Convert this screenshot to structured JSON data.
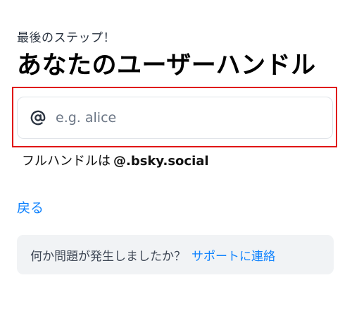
{
  "header": {
    "step_label": "最後のステップ！",
    "title": "あなたのユーザーハンドル"
  },
  "handle_field": {
    "icon": "at-icon",
    "placeholder": "e.g. alice",
    "value": ""
  },
  "full_handle": {
    "prefix": "フルハンドルは",
    "domain": "@.bsky.social"
  },
  "navigation": {
    "back_label": "戻る"
  },
  "help": {
    "text": "何か問題が発生しましたか？",
    "link_label": "サポートに連絡"
  },
  "colors": {
    "accent": "#1083fe",
    "highlight_border": "#e01616",
    "help_background": "#f1f3f5"
  }
}
